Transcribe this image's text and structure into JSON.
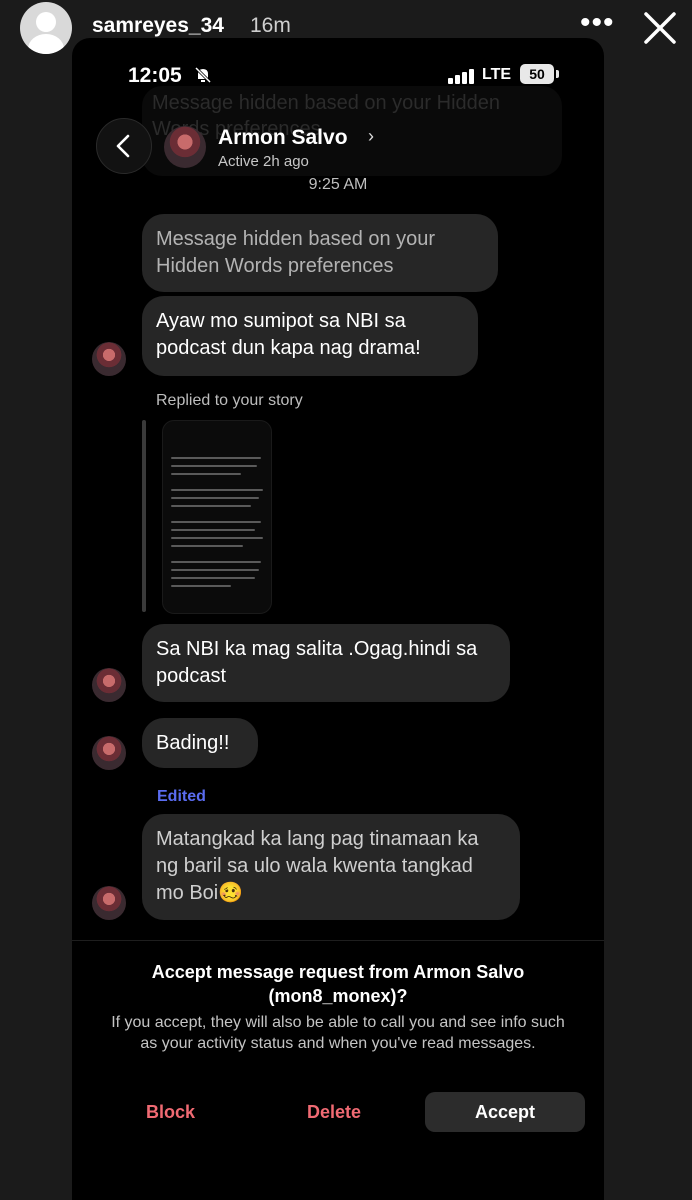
{
  "story": {
    "username": "samreyes_34",
    "time": "16m"
  },
  "phone_status": {
    "time": "12:05",
    "network": "LTE",
    "battery": "50"
  },
  "thread": {
    "name": "Armon Salvo",
    "status": "Active 2h ago",
    "timestamp": "9:25 AM",
    "ghost_text": "Message hidden based on your Hidden Words preferences"
  },
  "messages": [
    {
      "text": "Message hidden based on your Hidden Words preferences"
    },
    {
      "text": "Ayaw mo sumipot sa NBI sa podcast dun kapa nag drama!"
    },
    {
      "text": "Sa NBI ka mag salita .Ogag.hindi sa podcast"
    },
    {
      "text": "Bading!!"
    },
    {
      "text": "Matangkad ka lang pag tinamaan ka ng baril sa ulo wala kwenta tangkad mo Boi🥴"
    }
  ],
  "reply": {
    "label": "Replied to your story"
  },
  "edited_label": "Edited",
  "request": {
    "title": "Accept message request from Armon Salvo (mon8_monex)?",
    "body": "If you accept, they will also be able to call you and see info such as your activity status and when you've read messages.",
    "block_label": "Block",
    "delete_label": "Delete",
    "accept_label": "Accept"
  },
  "colors": {
    "bubble": "#262626",
    "danger": "#f06a73",
    "edited": "#5a6cf0"
  },
  "icons": [
    "back-chevron-icon",
    "bell-off-icon",
    "signal-icon",
    "close-icon",
    "more-icon"
  ]
}
